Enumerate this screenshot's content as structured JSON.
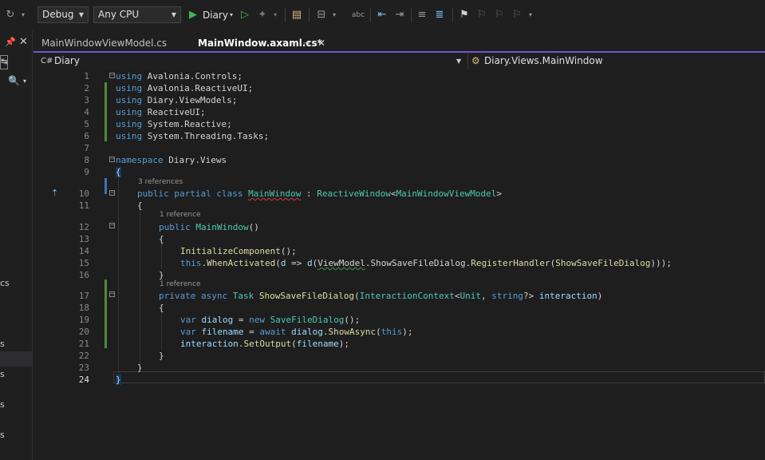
{
  "toolbar": {
    "config": "Debug",
    "platform": "Any CPU",
    "run_target": "Diary"
  },
  "left_panel": {
    "items": [
      "cs",
      "s",
      "s",
      "s",
      "s"
    ]
  },
  "tabs": [
    {
      "label": "MainWindowViewModel.cs",
      "active": false
    },
    {
      "label": "MainWindow.axaml.cs*",
      "active": true
    }
  ],
  "nav": {
    "project": "Diary",
    "member": "Diary.Views.MainWindow"
  },
  "editor": {
    "line_numbers": [
      "1",
      "2",
      "3",
      "4",
      "5",
      "6",
      "7",
      "8",
      "9",
      "10",
      "11",
      "12",
      "13",
      "14",
      "15",
      "16",
      "17",
      "18",
      "19",
      "20",
      "21",
      "22",
      "23",
      "24"
    ],
    "lens": {
      "class_refs": "3 references",
      "ctor_refs": "1 reference",
      "method_refs": "1 reference"
    }
  },
  "colors": {
    "accent": "#6e56cf",
    "keyword": "#569cd6",
    "type": "#4ec9b0",
    "method": "#dcdcaa",
    "variable": "#9cdcfe"
  }
}
